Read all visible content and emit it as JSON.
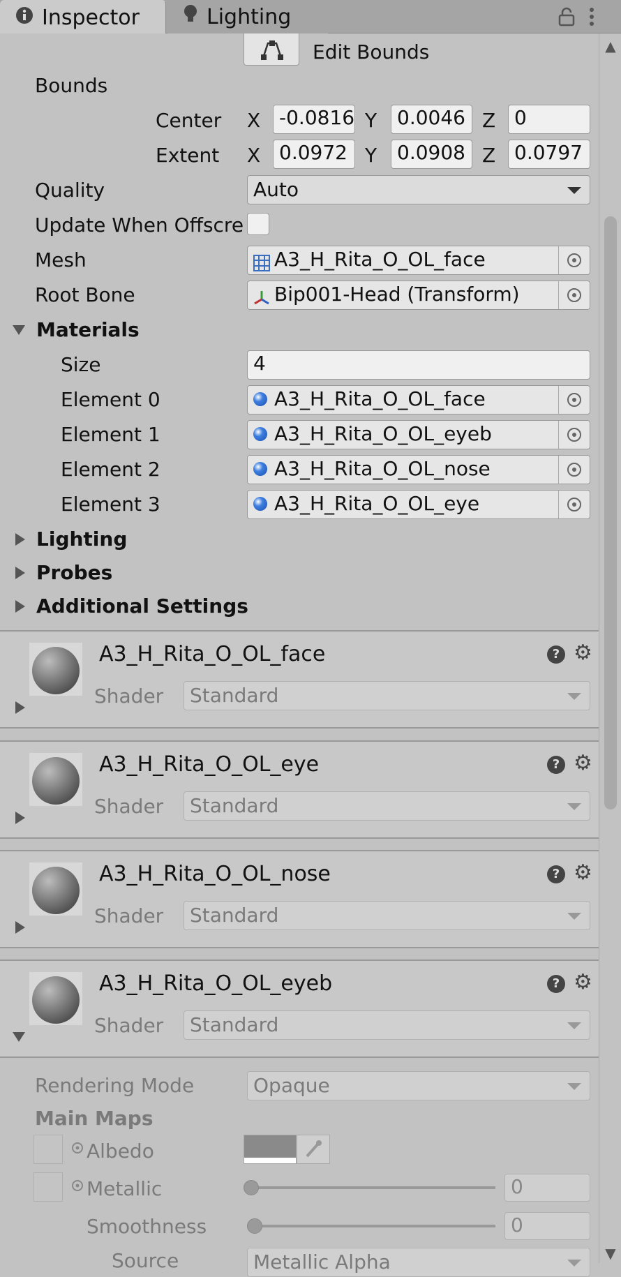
{
  "tabs": [
    {
      "label": "Inspector",
      "icon": "info-icon"
    },
    {
      "label": "Lighting",
      "icon": "lightbulb-icon"
    }
  ],
  "toolbar": {
    "lock_icon": "lock-icon",
    "menu_icon": "kebab-menu-icon"
  },
  "edit_bounds": {
    "label": "Edit Bounds"
  },
  "bounds": {
    "label": "Bounds",
    "center": {
      "label": "Center",
      "x": "-0.0816",
      "y": "0.0046",
      "z": "0"
    },
    "extent": {
      "label": "Extent",
      "x": "0.0972",
      "y": "0.0908",
      "z": "0.0797"
    },
    "axis_x": "X",
    "axis_y": "Y",
    "axis_z": "Z"
  },
  "quality": {
    "label": "Quality",
    "value": "Auto"
  },
  "update_offscreen": {
    "label": "Update When Offscre",
    "checked": false
  },
  "mesh": {
    "label": "Mesh",
    "value": "A3_H_Rita_O_OL_face"
  },
  "root_bone": {
    "label": "Root Bone",
    "value": "Bip001-Head (Transform)"
  },
  "materials": {
    "label": "Materials",
    "size_label": "Size",
    "size": "4",
    "elements": [
      {
        "label": "Element 0",
        "value": "A3_H_Rita_O_OL_face"
      },
      {
        "label": "Element 1",
        "value": "A3_H_Rita_O_OL_eyeb"
      },
      {
        "label": "Element 2",
        "value": "A3_H_Rita_O_OL_nose"
      },
      {
        "label": "Element 3",
        "value": "A3_H_Rita_O_OL_eye"
      }
    ]
  },
  "foldouts": {
    "lighting": "Lighting",
    "probes": "Probes",
    "additional": "Additional Settings"
  },
  "material_panels": [
    {
      "name": "A3_H_Rita_O_OL_face",
      "shader_label": "Shader",
      "shader": "Standard"
    },
    {
      "name": "A3_H_Rita_O_OL_eye",
      "shader_label": "Shader",
      "shader": "Standard"
    },
    {
      "name": "A3_H_Rita_O_OL_nose",
      "shader_label": "Shader",
      "shader": "Standard"
    },
    {
      "name": "A3_H_Rita_O_OL_eyeb",
      "shader_label": "Shader",
      "shader": "Standard"
    }
  ],
  "material_props": {
    "rendering_mode_label": "Rendering Mode",
    "rendering_mode": "Opaque",
    "main_maps": "Main Maps",
    "albedo_label": "Albedo",
    "albedo_color": "#8a8a8a",
    "metallic_label": "Metallic",
    "metallic_value": "0",
    "smoothness_label": "Smoothness",
    "smoothness_value": "0",
    "source_label": "Source",
    "source_value": "Metallic Alpha"
  }
}
